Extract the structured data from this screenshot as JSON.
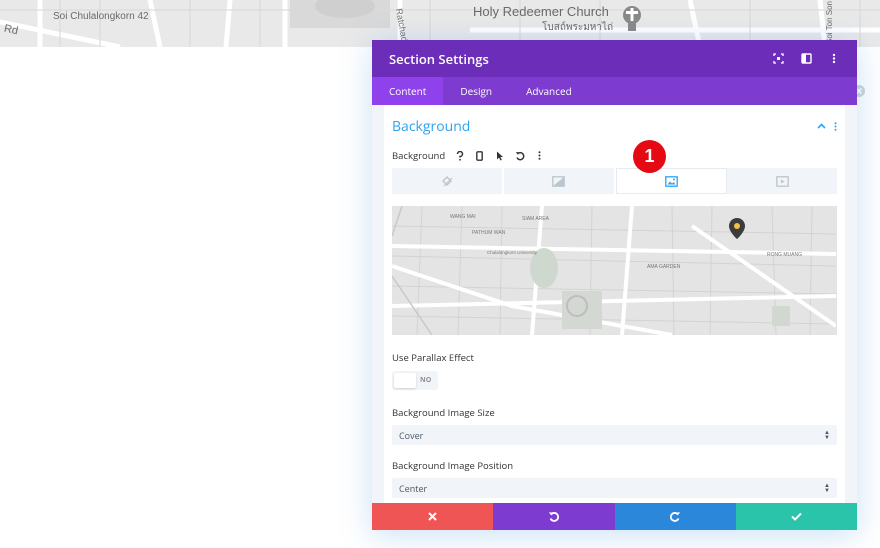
{
  "background_map": {
    "labels": [
      "Soi Chulalongkorn 42",
      "Rd",
      "Holy Redeemer Church",
      "โบสถ์พระมหาไถ่",
      "Ratchad",
      "Soi Ton Son"
    ]
  },
  "modal": {
    "title": "Section Settings",
    "tabs": [
      "Content",
      "Design",
      "Advanced"
    ],
    "active_tab": "Content",
    "section": {
      "title": "Background",
      "background_label": "Background",
      "badge_number": "1",
      "bg_type_tabs": [
        "color",
        "gradient",
        "image",
        "video"
      ],
      "active_bg_type": "image",
      "map_labels": [
        "WANG MAI",
        "PATHUM WAN",
        "SIAM AREA",
        "Chulalongkorn University",
        "AMA GARDEN",
        "RONG MUANG"
      ],
      "parallax_label": "Use Parallax Effect",
      "parallax_value": "NO",
      "size_label": "Background Image Size",
      "size_value": "Cover",
      "position_label": "Background Image Position",
      "position_value": "Center"
    }
  },
  "colors": {
    "header": "#6c2eb9",
    "tabs": "#7d3bcf",
    "accent": "#2ea3f2",
    "cancel": "#ef5555",
    "undo": "#7e3bd0",
    "redo": "#2b87da",
    "save": "#29c4a9",
    "badge": "#e50914"
  }
}
